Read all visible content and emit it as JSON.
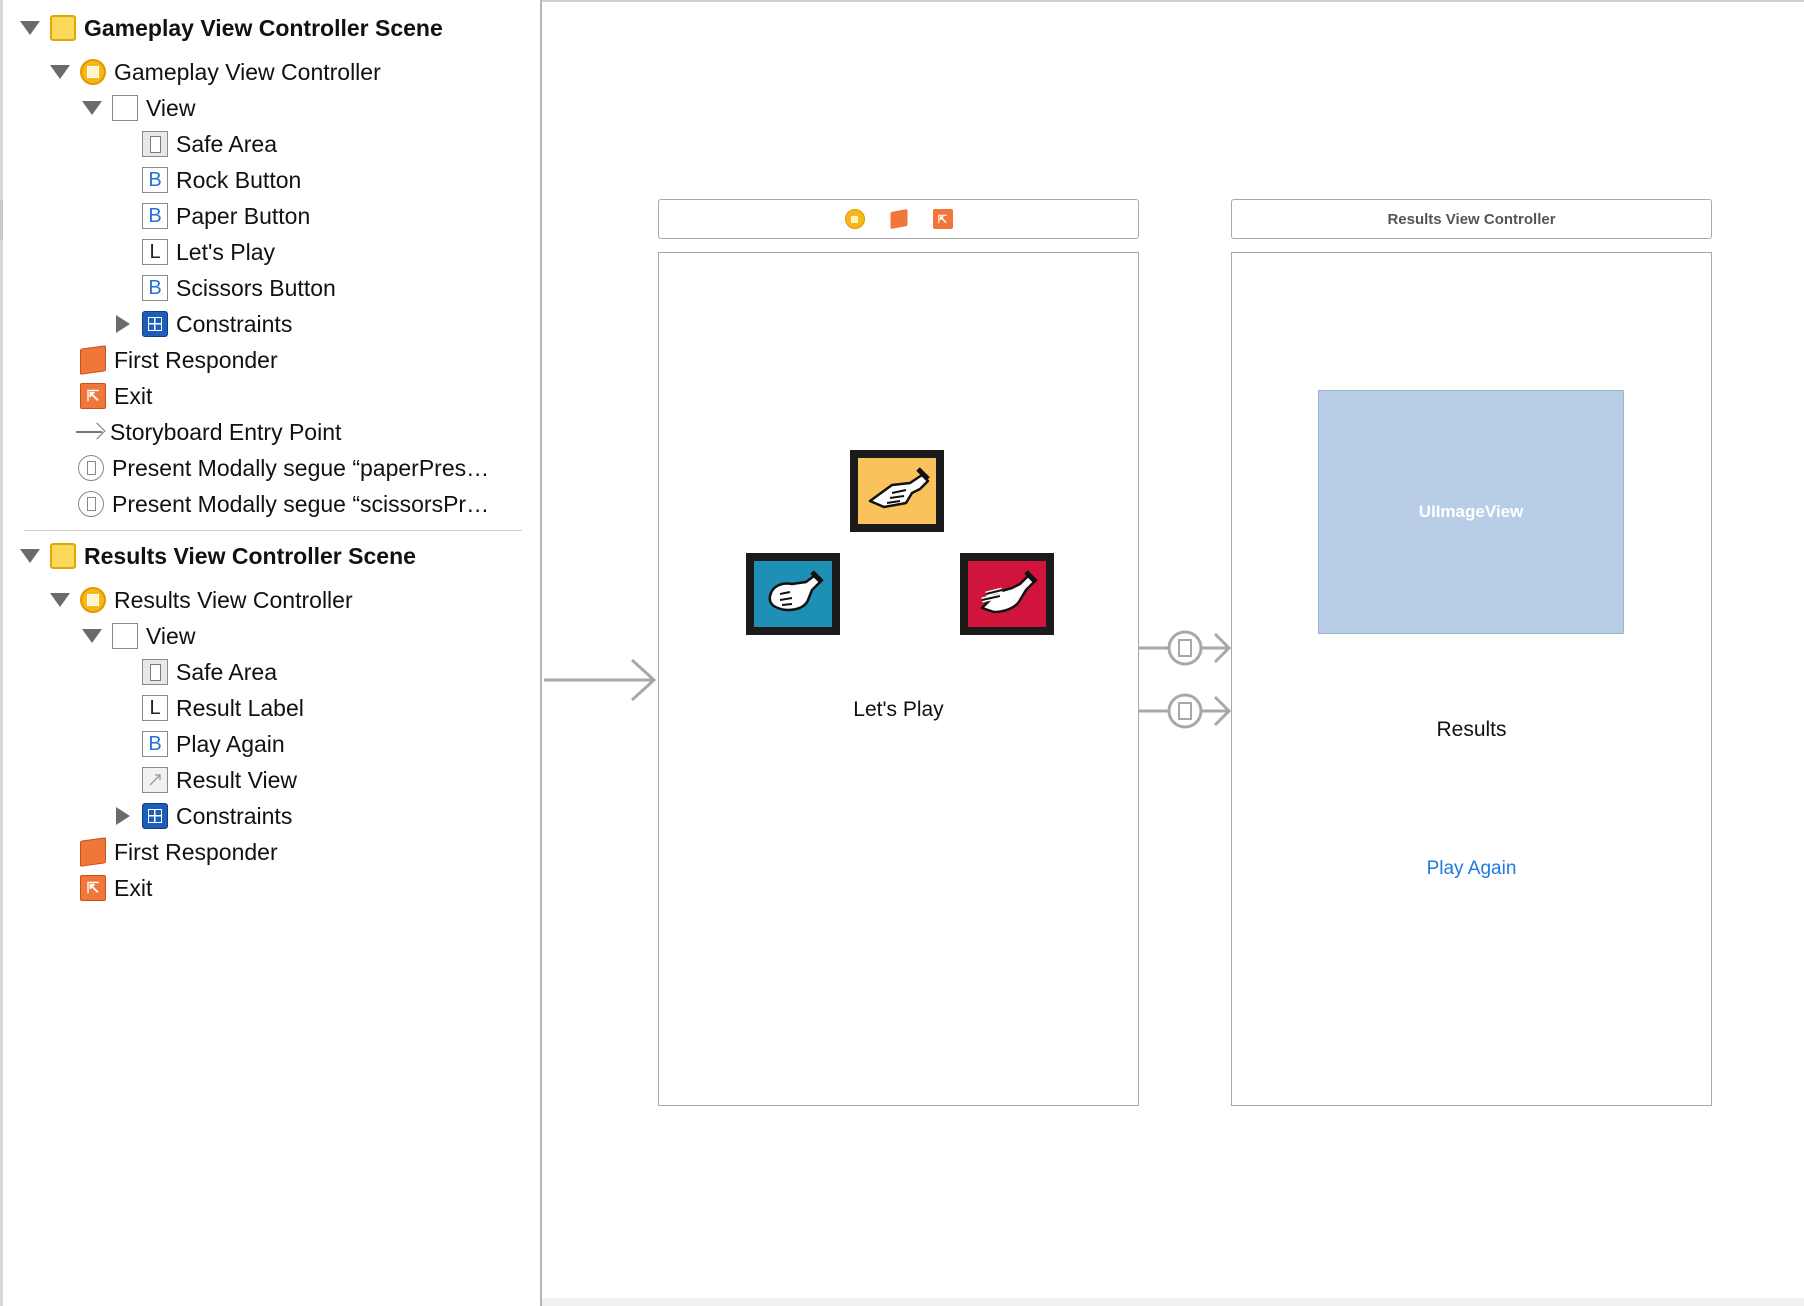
{
  "outline": {
    "scenes": [
      {
        "title": "Gameplay View Controller Scene",
        "controller": "Gameplay View Controller",
        "view": "View",
        "subviews": [
          {
            "kind": "safe",
            "label": "Safe Area"
          },
          {
            "kind": "B",
            "label": "Rock Button"
          },
          {
            "kind": "B",
            "label": "Paper Button"
          },
          {
            "kind": "L",
            "label": "Let's Play"
          },
          {
            "kind": "B",
            "label": "Scissors Button"
          }
        ],
        "constraints": "Constraints",
        "first_responder": "First Responder",
        "exit": "Exit",
        "entry_point": "Storyboard Entry Point",
        "segues": [
          "Present Modally segue “paperPres…",
          "Present Modally segue “scissorsPr…"
        ]
      },
      {
        "title": "Results View Controller Scene",
        "controller": "Results View Controller",
        "view": "View",
        "subviews": [
          {
            "kind": "safe",
            "label": "Safe Area"
          },
          {
            "kind": "L",
            "label": "Result Label"
          },
          {
            "kind": "B",
            "label": "Play Again"
          },
          {
            "kind": "image",
            "label": "Result View"
          }
        ],
        "constraints": "Constraints",
        "first_responder": "First Responder",
        "exit": "Exit"
      }
    ],
    "letter_b": "B",
    "letter_l": "L"
  },
  "canvas": {
    "gameplay": {
      "label": "Let's Play",
      "buttons": [
        {
          "name": "paper",
          "color": "#f9c25a"
        },
        {
          "name": "rock",
          "color": "#1e8fb5"
        },
        {
          "name": "scissors",
          "color": "#d0143c"
        }
      ]
    },
    "results": {
      "bar_title": "Results View Controller",
      "image_placeholder": "UIImageView",
      "result_label": "Results",
      "play_again": "Play Again"
    },
    "accent_colors": {
      "link": "#1f7ae0",
      "image_view": "#b8cde6",
      "controller": "#f7b718",
      "responder": "#f0763a"
    }
  }
}
